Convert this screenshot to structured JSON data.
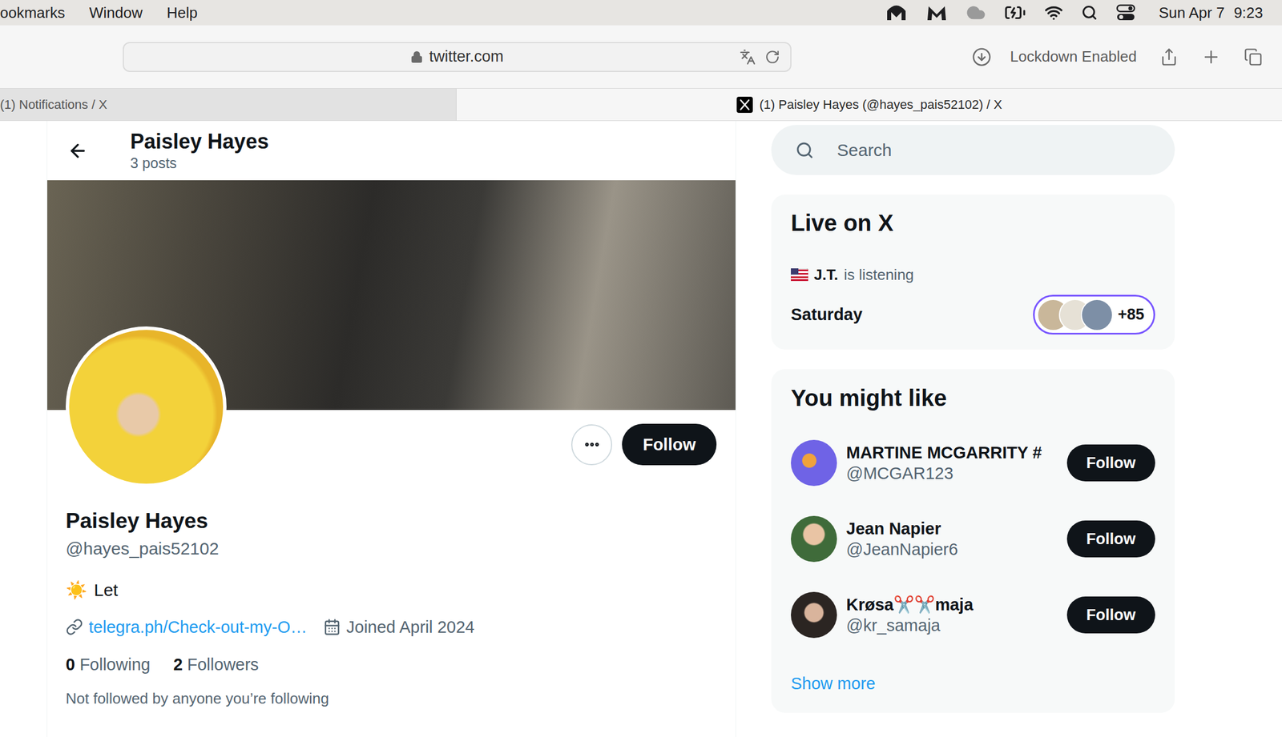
{
  "menu_bar": {
    "items": [
      "ookmarks",
      "Window",
      "Help"
    ],
    "date": "Sun Apr 7",
    "time": "9:23"
  },
  "browser": {
    "address": "twitter.com",
    "lockdown": "Lockdown Enabled",
    "tabs": [
      {
        "label": "(1) Notifications / X",
        "selected": false
      },
      {
        "label": "(1) Paisley Hayes (@hayes_pais52102) / X",
        "selected": true
      }
    ]
  },
  "profile": {
    "header_name": "Paisley Hayes",
    "post_count": "3 posts",
    "name": "Paisley Hayes",
    "handle": "@hayes_pais52102",
    "follow_button": "Follow",
    "bio_emoji": "☀️",
    "bio": "Let",
    "link": "telegra.ph/Check-out-my-O…",
    "joined": "Joined April 2024",
    "following_count": "0",
    "following_label": "Following",
    "followers_count": "2",
    "followers_label": "Followers",
    "followed_by": "Not followed by anyone you’re following"
  },
  "search": {
    "placeholder": "Search"
  },
  "live": {
    "title": "Live on X",
    "host": "J.T.",
    "activity": "is listening",
    "day": "Saturday",
    "listeners": "+85"
  },
  "suggestions": {
    "title": "You might like",
    "users": [
      {
        "name": "MARTINE MCGARRITY #",
        "handle": "@MCGAR123",
        "follow": "Follow"
      },
      {
        "name": "Jean Napier",
        "handle": "@JeanNapier6",
        "follow": "Follow"
      },
      {
        "name": "Krøsa✂️✂️maja",
        "handle": "@kr_samaja",
        "follow": "Follow"
      }
    ],
    "show_more": "Show more"
  }
}
